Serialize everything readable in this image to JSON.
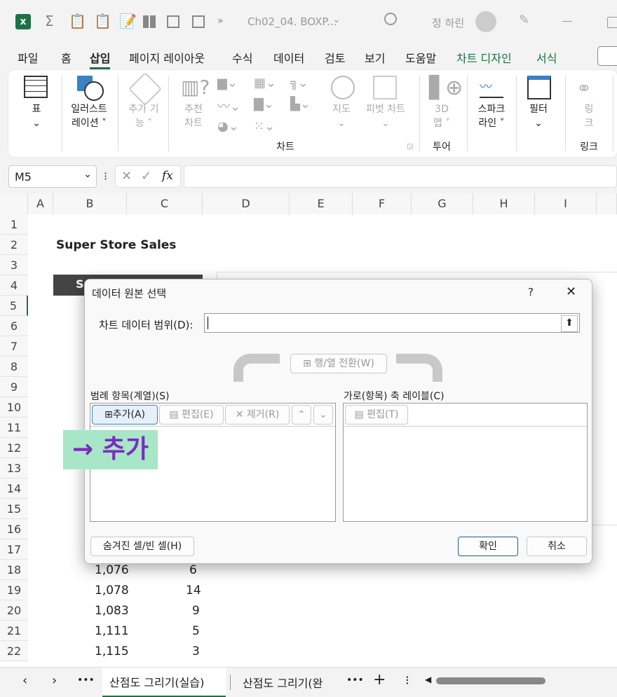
{
  "titlebar": {
    "filename": "Ch02_04. BOXP...",
    "user": "정 하린"
  },
  "menu": {
    "items": [
      "파일",
      "홈",
      "삽입",
      "페이지 레이아웃",
      "수식",
      "데이터",
      "검토",
      "보기",
      "도움말",
      "차트 디자인",
      "서식"
    ],
    "active": "삽입"
  },
  "ribbon": {
    "table": "표",
    "illust1": "일러스트",
    "illust2": "레이션 ˅",
    "addin1": "추가 기",
    "addin2": "능 ˅",
    "rec1": "추천",
    "rec2": "차트",
    "map": "지도",
    "pivot": "피벗 차트",
    "charts_group": "차트",
    "map3d1": "3D",
    "map3d2": "맵 ˅",
    "tour_group": "투어",
    "spark1": "스파크",
    "spark2": "라인 ˅",
    "filter": "필터",
    "link1": "링",
    "link2": "크",
    "link_group": "링크"
  },
  "formula": {
    "namebox": "M5",
    "fx": "fx",
    "value": ""
  },
  "grid": {
    "columns": [
      "A",
      "B",
      "C",
      "D",
      "E",
      "F",
      "G",
      "H",
      "I"
    ],
    "rows": [
      "1",
      "2",
      "3",
      "4",
      "5",
      "6",
      "7",
      "8",
      "9",
      "10",
      "11",
      "12",
      "13",
      "14",
      "15",
      "16",
      "17",
      "18",
      "19",
      "20",
      "21",
      "22"
    ],
    "title": "Super Store Sales",
    "b4_partial": "S",
    "data": [
      {
        "b": "1,076",
        "c": "6"
      },
      {
        "b": "1,078",
        "c": "14"
      },
      {
        "b": "1,083",
        "c": "9"
      },
      {
        "b": "1,111",
        "c": "5"
      },
      {
        "b": "1,115",
        "c": "3"
      }
    ]
  },
  "dialog": {
    "title": "데이터 원본 선택",
    "help": "?",
    "close": "✕",
    "range_label": "차트 데이터 범위(D):",
    "switch_btn": "행/열 전환(W)",
    "legend_label": "범례 항목(계열)(S)",
    "add_btn": "추가(A)",
    "edit_btn": "편집(E)",
    "remove_btn": "제거(R)",
    "axis_label": "가로(항목) 축 레이블(C)",
    "axis_edit_btn": "편집(T)",
    "hidden_btn": "숨겨진 셀/빈 셀(H)",
    "ok_btn": "확인",
    "cancel_btn": "취소"
  },
  "annotation": "→ 추가",
  "tabs": {
    "active": "산점도 그리기(실습)",
    "other": "산점도 그리기(완",
    "more": "•••",
    "add": "+"
  },
  "colors": {
    "excel_green": "#1e7145",
    "annotation_bg": "#a8e6c8",
    "annotation_text": "#7b2cbf"
  }
}
